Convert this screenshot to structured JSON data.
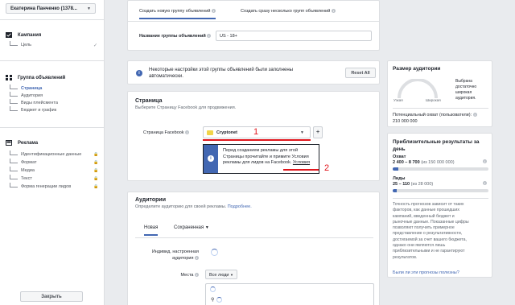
{
  "sidebar": {
    "account_name": "Екатерина Панченко (1378...",
    "sections": [
      {
        "label": "Кампания",
        "subs": [
          {
            "label": "Цель",
            "check": "✓"
          }
        ]
      },
      {
        "label": "Группа объявлений",
        "subs": [
          {
            "label": "Страница",
            "active": true
          },
          {
            "label": "Аудитория"
          },
          {
            "label": "Виды плейсмента"
          },
          {
            "label": "Бюджет и график"
          }
        ]
      },
      {
        "label": "Реклама",
        "subs": [
          {
            "label": "Идентификационные данные"
          },
          {
            "label": "Формат"
          },
          {
            "label": "Медиа"
          },
          {
            "label": "Текст"
          },
          {
            "label": "Форма генерации лидов"
          }
        ]
      }
    ],
    "close_label": "Закрыть"
  },
  "top_panel": {
    "tab_new": "Создать новую группу объявлений",
    "tab_multi": "Создать сразу несколько групп объявлений",
    "name_label": "Название группы объявлений",
    "name_value": "US - 18+"
  },
  "notice": {
    "text_line1": "Некоторые настройки этой группы объявлений были заполнены",
    "text_line2": "автоматически.",
    "reset_label": "Reset All"
  },
  "page_section": {
    "title": "Страница",
    "subtitle": "Выберите Страницу Facebook для продвижения.",
    "fb_page_label": "Страница Facebook",
    "page_value": "Cryptonet",
    "plus": "+",
    "warning_line1": "Перед созданием рекламы для этой",
    "warning_line2": "Страницы прочитайте и примите Условия",
    "warning_line3_pre": "рекламы для лидов на Facebook.",
    "warning_link": "Условия",
    "annot_1": "1",
    "annot_2": "2"
  },
  "audience_section": {
    "title": "Аудитории",
    "subtitle_pre": "Определите аудиторию для своей рекламы.",
    "subtitle_link": "Подробнее.",
    "tab_new": "Новая",
    "tab_saved": "Сохраненная",
    "custom_label_1": "Индивид. настроенная",
    "custom_label_2": "аудитория",
    "places_label": "Места",
    "places_value": "Все люди"
  },
  "audience_size": {
    "title": "Размер аудитории",
    "narrow": "Узкая",
    "wide": "Широкая",
    "desc_lines": [
      "Выбрана",
      "достаточно",
      "широкая",
      "аудитория."
    ],
    "potential_label": "Потенциальный охват (пользователи):",
    "potential_value": "210 000 000"
  },
  "results": {
    "title_line1": "Приблизительные результаты за",
    "title_line2": "день",
    "reach_label": "Охват",
    "reach_value": "2 400 – 8 700",
    "reach_suffix": "(из 150 000 000)",
    "reach_fraction": 0.06,
    "leads_label": "Лиды",
    "leads_value": "25 – 110",
    "leads_suffix": "(из 28 000)",
    "leads_fraction": 0.04,
    "note_lines": [
      "Точность прогнозов зависит от таких",
      "факторов, как данные прошедших",
      "кампаний, введенный бюджет и",
      "рыночные данные. Показанные цифры",
      "позволяют получить примерное",
      "представление о результативности,",
      "достигаемой за счет вашего бюджета,",
      "однако они являются лишь",
      "приблизительными и не гарантируют",
      "результатов."
    ],
    "feedback_link": "Были ли эти прогнозы полезны?"
  },
  "colors": {
    "accent": "#4267b2",
    "annotation": "#e0161d",
    "warning_bg": "#fff9d7"
  }
}
